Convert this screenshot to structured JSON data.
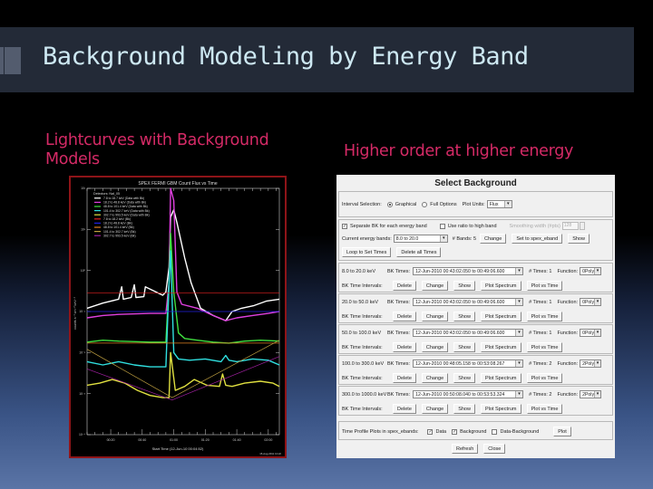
{
  "slide": {
    "title": "Background Modeling by Energy Band",
    "left_heading": "Lightcurves with Background Models",
    "right_heading": "Higher order at higher energy"
  },
  "colors": {
    "title_bar": "#232a37",
    "title_text": "#cde8f2",
    "heading_text": "#d52a66",
    "chart_frame": "#8e1418"
  },
  "chart_data": {
    "type": "line",
    "title": "SPEX FERMI GBM Count Flux vs Time",
    "xlabel": "Start Time (12-Jun-10 00:04:52)",
    "ylabel": "counts s⁻¹ cm⁻² keV⁻¹",
    "yscale": "log",
    "ylim": [
      0.0001,
      100
    ],
    "ytick_labels": [
      "10⁻⁴",
      "10⁻³",
      "10⁻²",
      "10⁻¹",
      "10⁰",
      "10¹",
      "10²"
    ],
    "xlim_minutes": [
      0,
      122
    ],
    "xtick_labels": [
      "00:20",
      "00:40",
      "01:00",
      "01:20",
      "01:40",
      "02:00"
    ],
    "footer": "15-Aug-2011 13:22",
    "legend_header": "Detectors: NaI_05",
    "legend": [
      {
        "label": "7.8 to 18.7 keV (Data with Bk)",
        "color": "#ffffff"
      },
      {
        "label": "18.2 to 48.8 keV (Data with Bk)",
        "color": "#e040e0"
      },
      {
        "label": "48.8 to 101.4 keV (Data with Bk)",
        "color": "#40e040"
      },
      {
        "label": "101.4 to 302.7 keV (Data with Bk)",
        "color": "#30e0e0"
      },
      {
        "label": "302.7 to 993.5 keV (Data with Bk)",
        "color": "#e0e040"
      },
      {
        "label": "7.8 to 18.2 keV (Bk)",
        "color": "#e02020"
      },
      {
        "label": "18.2 to 48.8 keV (Bk)",
        "color": "#2020e0"
      },
      {
        "label": "48.8 to 101.4 keV (Bk)",
        "color": "#e08020"
      },
      {
        "label": "101.4 to 302.7 keV (Bk)",
        "color": "#c0a040"
      },
      {
        "label": "302.7 to 993.5 keV (Bk)",
        "color": "#a020a0"
      }
    ],
    "series": [
      {
        "name": "7.8-18.7 keV data",
        "color": "#ffffff",
        "x": [
          0,
          10,
          20,
          22,
          23,
          28,
          30,
          31,
          36,
          37,
          48,
          50,
          52,
          53,
          55,
          57,
          62,
          66,
          72,
          80,
          88,
          92,
          98,
          106,
          114,
          122
        ],
        "y": [
          0.12,
          0.16,
          0.2,
          0.4,
          0.2,
          0.22,
          0.45,
          0.22,
          0.23,
          0.4,
          0.25,
          0.3,
          1.2,
          20,
          30,
          15,
          2,
          0.5,
          0.12,
          0.08,
          0.06,
          0.1,
          0.12,
          0.14,
          0.18,
          0.2
        ]
      },
      {
        "name": "18.2-48.8 keV data",
        "color": "#e040e0",
        "x": [
          0,
          10,
          20,
          40,
          50,
          52,
          53,
          55,
          57,
          60,
          70,
          80,
          88,
          95,
          105,
          115,
          122
        ],
        "y": [
          0.07,
          0.08,
          0.085,
          0.09,
          0.09,
          0.5,
          100,
          50,
          0.3,
          0.15,
          0.12,
          0.08,
          0.06,
          0.07,
          0.08,
          0.09,
          0.1
        ]
      },
      {
        "name": "48.8-101.4 keV data",
        "color": "#40e040",
        "x": [
          0,
          10,
          20,
          40,
          50,
          52,
          53,
          55,
          58,
          62,
          70,
          80,
          90,
          100,
          110,
          122
        ],
        "y": [
          0.018,
          0.02,
          0.019,
          0.018,
          0.018,
          0.5,
          8,
          0.3,
          0.03,
          0.022,
          0.02,
          0.018,
          0.017,
          0.019,
          0.02,
          0.019
        ]
      },
      {
        "name": "101.4-302.7 keV data",
        "color": "#30e0e0",
        "x": [
          0,
          10,
          20,
          30,
          40,
          50,
          52,
          53,
          55,
          58,
          65,
          75,
          85,
          88,
          90,
          95,
          105,
          115,
          122
        ],
        "y": [
          0.006,
          0.005,
          0.006,
          0.005,
          0.0045,
          0.0045,
          0.5,
          3,
          0.01,
          0.007,
          0.0065,
          0.007,
          0.006,
          0.0085,
          0.0065,
          0.006,
          0.007,
          0.0065,
          0.005
        ]
      },
      {
        "name": "302.7-993.5 keV data",
        "color": "#e0e040",
        "x": [
          0,
          8,
          16,
          24,
          32,
          40,
          48,
          52,
          53,
          56,
          62,
          68,
          76,
          84,
          86,
          88,
          92,
          100,
          110,
          118,
          122
        ],
        "y": [
          0.0016,
          0.0018,
          0.0022,
          0.0018,
          0.0012,
          0.0009,
          0.0008,
          0.0008,
          0.01,
          0.0012,
          0.0015,
          0.0022,
          0.0016,
          0.0015,
          0.003,
          0.0016,
          0.0015,
          0.0018,
          0.002,
          0.0018,
          0.0015
        ]
      },
      {
        "name": "7.8-18.2 keV bk",
        "color": "#e02020",
        "x": [
          0,
          122
        ],
        "y": [
          0.28,
          0.28
        ]
      },
      {
        "name": "18.2-48.8 keV bk",
        "color": "#2020e0",
        "x": [
          0,
          122
        ],
        "y": [
          0.1,
          0.1
        ]
      },
      {
        "name": "48.8-101.4 keV bk",
        "color": "#e08020",
        "x": [
          0,
          122
        ],
        "y": [
          0.017,
          0.017
        ]
      },
      {
        "name": "101.4-302.7 keV bk",
        "color": "#c0a040",
        "x": [
          0,
          54,
          122
        ],
        "y": [
          0.012,
          0.0008,
          0.02
        ]
      },
      {
        "name": "302.7-993.5 keV bk",
        "color": "#a020a0",
        "x": [
          0,
          54,
          122
        ],
        "y": [
          0.004,
          0.0007,
          0.008
        ]
      }
    ]
  },
  "dialog": {
    "title": "Select Background",
    "interval_selection_label": "Interval Selection:",
    "radio_graphical": "Graphical",
    "radio_full_options": "Full Options",
    "plot_units_label": "Plot Units:",
    "plot_units_value": "Flux",
    "separate_bk_label": "Separate BK for each energy band",
    "separate_bk_checked": true,
    "use_ratio_label": "Use ratio to high band",
    "use_ratio_checked": false,
    "smoothing_label": "Smoothing width (#pts)",
    "smoothing_value": "128",
    "current_bands_label": "Current energy bands:",
    "current_bands_value": "8.0 to 20.0",
    "nbands_label": "# Bands: 5",
    "change_label": "Change",
    "set_to_spex_label": "Set to spex_eband",
    "show_label": "Show",
    "loop_label": "Loop to Set Times",
    "delete_all_label": "Delete all Times",
    "bk_times_label": "BK Times:",
    "function_label": "Function:",
    "bk_intervals_label": "BK Time Intervals:",
    "btn_delete": "Delete",
    "btn_change": "Change",
    "btn_show": "Show",
    "btn_plot_spectrum": "Plot Spectrum",
    "btn_plot_vs_time": "Plot vs Time",
    "bands": [
      {
        "range": "8.0 to 20.0 keV",
        "times": "12-Jun-2010 00:43:02.050 to 00:49:06.600",
        "ntimes": "# Times: 1",
        "function": "0Poly"
      },
      {
        "range": "20.0 to 50.0 keV",
        "times": "12-Jun-2010 00:43:02.050 to 00:49:06.600",
        "ntimes": "# Times: 1",
        "function": "0Poly"
      },
      {
        "range": "50.0 to 100.0 keV",
        "times": "12-Jun-2010 00:43:02.050 to 00:49:06.600",
        "ntimes": "# Times: 1",
        "function": "0Poly"
      },
      {
        "range": "100.0 to 300.0 keV",
        "times": "12-Jun-2010 00:48:05.158 to 00:53:08.267",
        "ntimes": "# Times: 2",
        "function": "2Poly"
      },
      {
        "range": "300.0 to 1000.0 keV",
        "times": "12-Jun-2010 00:50:08.040 to 00:53:53.324",
        "ntimes": "# Times: 2",
        "function": "2Poly"
      }
    ],
    "time_profile_label": "Time Profile Plots in spex_ebands:",
    "chk_data": "Data",
    "chk_data_checked": true,
    "chk_background": "Background",
    "chk_background_checked": true,
    "chk_data_bk": "Data-Background",
    "chk_data_bk_checked": false,
    "btn_plot": "Plot",
    "btn_refresh": "Refresh",
    "btn_close": "Close"
  }
}
